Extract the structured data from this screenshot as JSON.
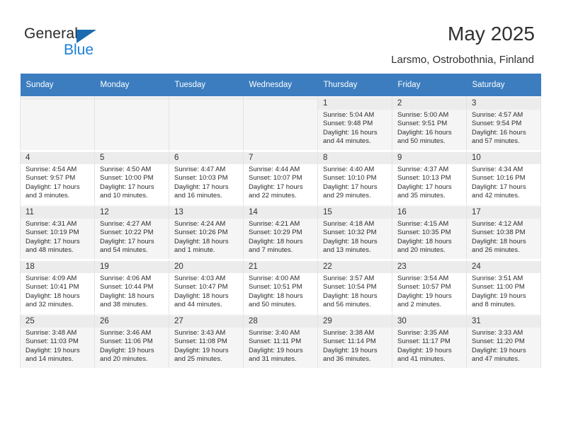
{
  "brand": {
    "name_top": "General",
    "name_bottom": "Blue",
    "triangle_color": "#1c6bb0",
    "blue_color": "#1c7fd6"
  },
  "header": {
    "title": "May 2025",
    "subtitle": "Larsmo, Ostrobothnia, Finland"
  },
  "theme": {
    "header_bg": "#3b7dbf",
    "header_text": "#ffffff",
    "row_alt_bg": "#f5f5f5",
    "daynum_band_bg": "#ececec",
    "text": "#2d2d2d"
  },
  "calendar": {
    "weekday_headers": [
      "Sunday",
      "Monday",
      "Tuesday",
      "Wednesday",
      "Thursday",
      "Friday",
      "Saturday"
    ],
    "weeks": [
      [
        {
          "day": ""
        },
        {
          "day": ""
        },
        {
          "day": ""
        },
        {
          "day": ""
        },
        {
          "day": "1",
          "sunrise": "Sunrise: 5:04 AM",
          "sunset": "Sunset: 9:48 PM",
          "daylight_1": "Daylight: 16 hours",
          "daylight_2": "and 44 minutes."
        },
        {
          "day": "2",
          "sunrise": "Sunrise: 5:00 AM",
          "sunset": "Sunset: 9:51 PM",
          "daylight_1": "Daylight: 16 hours",
          "daylight_2": "and 50 minutes."
        },
        {
          "day": "3",
          "sunrise": "Sunrise: 4:57 AM",
          "sunset": "Sunset: 9:54 PM",
          "daylight_1": "Daylight: 16 hours",
          "daylight_2": "and 57 minutes."
        }
      ],
      [
        {
          "day": "4",
          "sunrise": "Sunrise: 4:54 AM",
          "sunset": "Sunset: 9:57 PM",
          "daylight_1": "Daylight: 17 hours",
          "daylight_2": "and 3 minutes."
        },
        {
          "day": "5",
          "sunrise": "Sunrise: 4:50 AM",
          "sunset": "Sunset: 10:00 PM",
          "daylight_1": "Daylight: 17 hours",
          "daylight_2": "and 10 minutes."
        },
        {
          "day": "6",
          "sunrise": "Sunrise: 4:47 AM",
          "sunset": "Sunset: 10:03 PM",
          "daylight_1": "Daylight: 17 hours",
          "daylight_2": "and 16 minutes."
        },
        {
          "day": "7",
          "sunrise": "Sunrise: 4:44 AM",
          "sunset": "Sunset: 10:07 PM",
          "daylight_1": "Daylight: 17 hours",
          "daylight_2": "and 22 minutes."
        },
        {
          "day": "8",
          "sunrise": "Sunrise: 4:40 AM",
          "sunset": "Sunset: 10:10 PM",
          "daylight_1": "Daylight: 17 hours",
          "daylight_2": "and 29 minutes."
        },
        {
          "day": "9",
          "sunrise": "Sunrise: 4:37 AM",
          "sunset": "Sunset: 10:13 PM",
          "daylight_1": "Daylight: 17 hours",
          "daylight_2": "and 35 minutes."
        },
        {
          "day": "10",
          "sunrise": "Sunrise: 4:34 AM",
          "sunset": "Sunset: 10:16 PM",
          "daylight_1": "Daylight: 17 hours",
          "daylight_2": "and 42 minutes."
        }
      ],
      [
        {
          "day": "11",
          "sunrise": "Sunrise: 4:31 AM",
          "sunset": "Sunset: 10:19 PM",
          "daylight_1": "Daylight: 17 hours",
          "daylight_2": "and 48 minutes."
        },
        {
          "day": "12",
          "sunrise": "Sunrise: 4:27 AM",
          "sunset": "Sunset: 10:22 PM",
          "daylight_1": "Daylight: 17 hours",
          "daylight_2": "and 54 minutes."
        },
        {
          "day": "13",
          "sunrise": "Sunrise: 4:24 AM",
          "sunset": "Sunset: 10:26 PM",
          "daylight_1": "Daylight: 18 hours",
          "daylight_2": "and 1 minute."
        },
        {
          "day": "14",
          "sunrise": "Sunrise: 4:21 AM",
          "sunset": "Sunset: 10:29 PM",
          "daylight_1": "Daylight: 18 hours",
          "daylight_2": "and 7 minutes."
        },
        {
          "day": "15",
          "sunrise": "Sunrise: 4:18 AM",
          "sunset": "Sunset: 10:32 PM",
          "daylight_1": "Daylight: 18 hours",
          "daylight_2": "and 13 minutes."
        },
        {
          "day": "16",
          "sunrise": "Sunrise: 4:15 AM",
          "sunset": "Sunset: 10:35 PM",
          "daylight_1": "Daylight: 18 hours",
          "daylight_2": "and 20 minutes."
        },
        {
          "day": "17",
          "sunrise": "Sunrise: 4:12 AM",
          "sunset": "Sunset: 10:38 PM",
          "daylight_1": "Daylight: 18 hours",
          "daylight_2": "and 26 minutes."
        }
      ],
      [
        {
          "day": "18",
          "sunrise": "Sunrise: 4:09 AM",
          "sunset": "Sunset: 10:41 PM",
          "daylight_1": "Daylight: 18 hours",
          "daylight_2": "and 32 minutes."
        },
        {
          "day": "19",
          "sunrise": "Sunrise: 4:06 AM",
          "sunset": "Sunset: 10:44 PM",
          "daylight_1": "Daylight: 18 hours",
          "daylight_2": "and 38 minutes."
        },
        {
          "day": "20",
          "sunrise": "Sunrise: 4:03 AM",
          "sunset": "Sunset: 10:47 PM",
          "daylight_1": "Daylight: 18 hours",
          "daylight_2": "and 44 minutes."
        },
        {
          "day": "21",
          "sunrise": "Sunrise: 4:00 AM",
          "sunset": "Sunset: 10:51 PM",
          "daylight_1": "Daylight: 18 hours",
          "daylight_2": "and 50 minutes."
        },
        {
          "day": "22",
          "sunrise": "Sunrise: 3:57 AM",
          "sunset": "Sunset: 10:54 PM",
          "daylight_1": "Daylight: 18 hours",
          "daylight_2": "and 56 minutes."
        },
        {
          "day": "23",
          "sunrise": "Sunrise: 3:54 AM",
          "sunset": "Sunset: 10:57 PM",
          "daylight_1": "Daylight: 19 hours",
          "daylight_2": "and 2 minutes."
        },
        {
          "day": "24",
          "sunrise": "Sunrise: 3:51 AM",
          "sunset": "Sunset: 11:00 PM",
          "daylight_1": "Daylight: 19 hours",
          "daylight_2": "and 8 minutes."
        }
      ],
      [
        {
          "day": "25",
          "sunrise": "Sunrise: 3:48 AM",
          "sunset": "Sunset: 11:03 PM",
          "daylight_1": "Daylight: 19 hours",
          "daylight_2": "and 14 minutes."
        },
        {
          "day": "26",
          "sunrise": "Sunrise: 3:46 AM",
          "sunset": "Sunset: 11:06 PM",
          "daylight_1": "Daylight: 19 hours",
          "daylight_2": "and 20 minutes."
        },
        {
          "day": "27",
          "sunrise": "Sunrise: 3:43 AM",
          "sunset": "Sunset: 11:08 PM",
          "daylight_1": "Daylight: 19 hours",
          "daylight_2": "and 25 minutes."
        },
        {
          "day": "28",
          "sunrise": "Sunrise: 3:40 AM",
          "sunset": "Sunset: 11:11 PM",
          "daylight_1": "Daylight: 19 hours",
          "daylight_2": "and 31 minutes."
        },
        {
          "day": "29",
          "sunrise": "Sunrise: 3:38 AM",
          "sunset": "Sunset: 11:14 PM",
          "daylight_1": "Daylight: 19 hours",
          "daylight_2": "and 36 minutes."
        },
        {
          "day": "30",
          "sunrise": "Sunrise: 3:35 AM",
          "sunset": "Sunset: 11:17 PM",
          "daylight_1": "Daylight: 19 hours",
          "daylight_2": "and 41 minutes."
        },
        {
          "day": "31",
          "sunrise": "Sunrise: 3:33 AM",
          "sunset": "Sunset: 11:20 PM",
          "daylight_1": "Daylight: 19 hours",
          "daylight_2": "and 47 minutes."
        }
      ]
    ]
  }
}
